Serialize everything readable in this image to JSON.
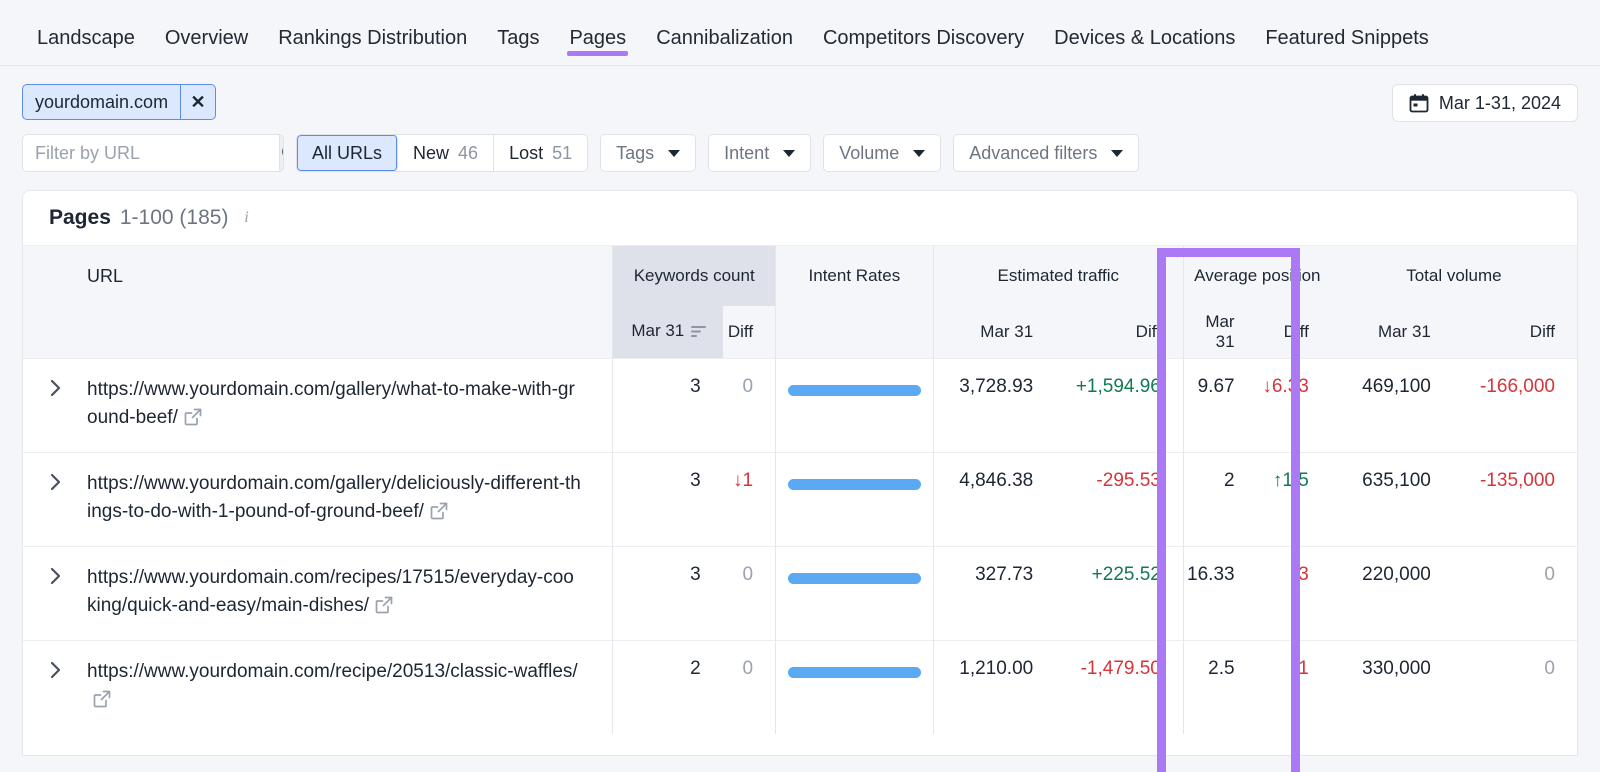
{
  "tabs": [
    {
      "label": "Landscape",
      "active": false
    },
    {
      "label": "Overview",
      "active": false
    },
    {
      "label": "Rankings Distribution",
      "active": false
    },
    {
      "label": "Tags",
      "active": false
    },
    {
      "label": "Pages",
      "active": true
    },
    {
      "label": "Cannibalization",
      "active": false
    },
    {
      "label": "Competitors Discovery",
      "active": false
    },
    {
      "label": "Devices & Locations",
      "active": false
    },
    {
      "label": "Featured Snippets",
      "active": false
    }
  ],
  "filters": {
    "domain_chip": "yourdomain.com",
    "remove_chip_label": "✕",
    "search_placeholder": "Filter by URL",
    "search_value": "",
    "segments": [
      {
        "label": "All URLs",
        "count": "",
        "active": true
      },
      {
        "label": "New",
        "count": "46",
        "active": false
      },
      {
        "label": "Lost",
        "count": "51",
        "active": false
      }
    ],
    "dropdowns": [
      {
        "label": "Tags"
      },
      {
        "label": "Intent"
      },
      {
        "label": "Volume"
      },
      {
        "label": "Advanced filters"
      }
    ],
    "date_range": "Mar 1-31, 2024"
  },
  "card": {
    "title": "Pages",
    "range": "1-100 (185)",
    "info_glyph": "i"
  },
  "table": {
    "groups": {
      "url": "URL",
      "keywords_count": "Keywords count",
      "intent_rates": "Intent Rates",
      "estimated_traffic": "Estimated traffic",
      "average_position": "Average position",
      "total_volume": "Total volume"
    },
    "sub": {
      "kw_date": "Mar 31",
      "kw_diff": "Diff",
      "et_date": "Mar 31",
      "et_diff": "Diff",
      "ap_date": "Mar 31",
      "ap_diff": "Diff",
      "tv_date": "Mar 31",
      "tv_diff": "Diff"
    },
    "rows": [
      {
        "url": "https://www.yourdomain.com/gallery/what-to-make-with-ground-beef/",
        "kw_count": "3",
        "kw_diff": "0",
        "kw_diff_kind": "zero",
        "intent_bar_pct": 100,
        "traffic": "3,728.93",
        "traffic_diff": "+1,594.96",
        "traffic_diff_kind": "pos",
        "avg_position": "9.67",
        "avg_position_diff": "↓6.33",
        "avg_position_diff_kind": "neg",
        "volume": "469,100",
        "volume_diff": "-166,000",
        "volume_diff_kind": "neg"
      },
      {
        "url": "https://www.yourdomain.com/gallery/deliciously-different-things-to-do-with-1-pound-of-ground-beef/",
        "kw_count": "3",
        "kw_diff": "↓1",
        "kw_diff_kind": "neg",
        "intent_bar_pct": 100,
        "traffic": "4,846.38",
        "traffic_diff": "-295.53",
        "traffic_diff_kind": "neg",
        "avg_position": "2",
        "avg_position_diff": "↑1.5",
        "avg_position_diff_kind": "pos",
        "volume": "635,100",
        "volume_diff": "-135,000",
        "volume_diff_kind": "neg"
      },
      {
        "url": "https://www.yourdomain.com/recipes/17515/everyday-cooking/quick-and-easy/main-dishes/",
        "kw_count": "3",
        "kw_diff": "0",
        "kw_diff_kind": "zero",
        "intent_bar_pct": 100,
        "traffic": "327.73",
        "traffic_diff": "+225.52",
        "traffic_diff_kind": "pos",
        "avg_position": "16.33",
        "avg_position_diff": "↓3",
        "avg_position_diff_kind": "neg",
        "volume": "220,000",
        "volume_diff": "0",
        "volume_diff_kind": "zero"
      },
      {
        "url": "https://www.yourdomain.com/recipe/20513/classic-waffles/",
        "kw_count": "2",
        "kw_diff": "0",
        "kw_diff_kind": "zero",
        "intent_bar_pct": 100,
        "traffic": "1,210.00",
        "traffic_diff": "-1,479.50",
        "traffic_diff_kind": "neg",
        "avg_position": "2.5",
        "avg_position_diff": "↓1",
        "avg_position_diff_kind": "neg",
        "volume": "330,000",
        "volume_diff": "0",
        "volume_diff_kind": "zero"
      }
    ]
  },
  "colors": {
    "accent_purple": "#ab79f3",
    "bar_blue": "#5aa9f2",
    "positive_green": "#117a50",
    "negative_red": "#d4343a",
    "chip_blue": "#5b8def"
  }
}
